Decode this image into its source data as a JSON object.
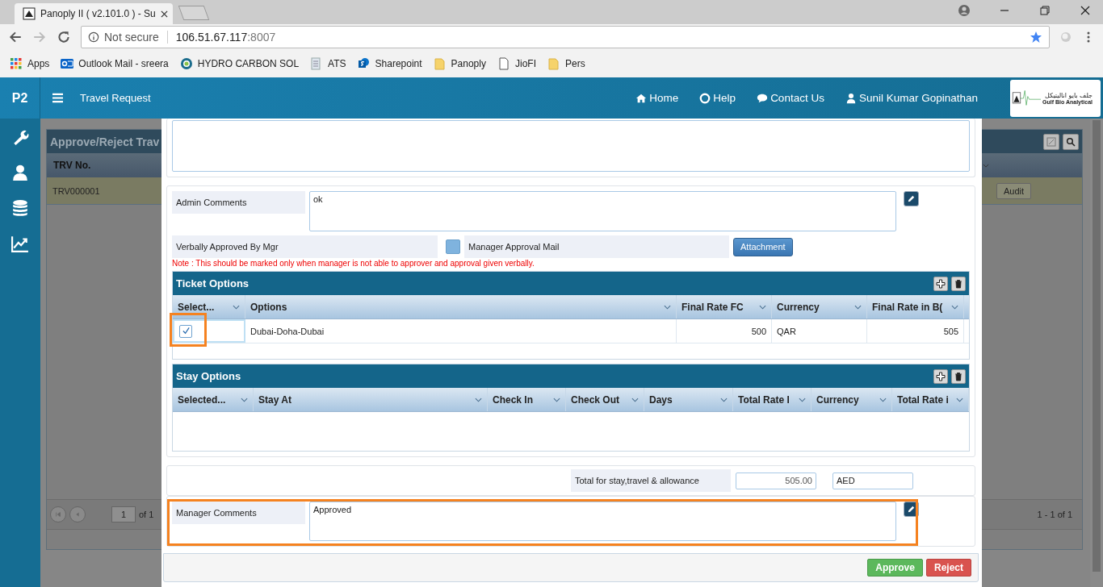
{
  "browser": {
    "tabs": [
      {
        "title": "Panoply II ( v2.101.0 ) - Su",
        "selected": true
      }
    ],
    "security": "Not secure",
    "url_host": "106.51.67.117",
    "url_port": ":8007",
    "bookmarks": [
      {
        "label": "Apps",
        "kind": "apps"
      },
      {
        "label": "Outlook Mail - sreera",
        "kind": "outlook"
      },
      {
        "label": "HYDRO CARBON SOL",
        "kind": "ring"
      },
      {
        "label": "ATS",
        "kind": "document"
      },
      {
        "label": "Sharepoint",
        "kind": "sharepoint"
      },
      {
        "label": "Panoply",
        "kind": "folder"
      },
      {
        "label": "JioFI",
        "kind": "page"
      },
      {
        "label": "Pers",
        "kind": "folder"
      }
    ]
  },
  "app": {
    "logo": "P2",
    "title": "Travel Request",
    "nav": [
      {
        "label": "Home",
        "kind": "home"
      },
      {
        "label": "Help",
        "kind": "help"
      },
      {
        "label": "Contact Us",
        "kind": "chat"
      }
    ],
    "user": "Sunil Kumar Gopinathan",
    "company_arabic": "جلف بايو اناليتيكل",
    "company_name": "Gulf Bio Analytical"
  },
  "background_list": {
    "title": "Approve/Reject Trav",
    "column": "TRV No.",
    "row": "TRV000001",
    "action": "Audit",
    "page": "1",
    "page_of": "of 1",
    "range": "1 - 1 of 1"
  },
  "form": {
    "admin_comments": {
      "label": "Admin Comments",
      "value": "ok"
    },
    "verbally_approved": {
      "label": "Verbally Approved By Mgr",
      "checked": false
    },
    "approval_mail": {
      "label": "Manager Approval Mail",
      "button": "Attachment"
    },
    "note": "Note : This should be marked only when manager is not able to approver and approval given verbally.",
    "ticket_options": {
      "title": "Ticket Options",
      "columns": [
        "Select...",
        "Options",
        "Final Rate FC",
        "Currency",
        "Final Rate in B("
      ],
      "rows": [
        {
          "checked": true,
          "option": "Dubai-Doha-Dubai",
          "final_rate_fc": "500",
          "currency": "QAR",
          "final_rate": "505"
        }
      ]
    },
    "stay_options": {
      "title": "Stay Options",
      "columns": [
        "Selected...",
        "Stay At",
        "Check In",
        "Check Out",
        "Days",
        "Total Rate I",
        "Currency",
        "Total Rate i"
      ]
    },
    "total": {
      "label": "Total for stay,travel & allowance",
      "amount": "505.00",
      "currency": "AED"
    },
    "manager_comments": {
      "label": "Manager Comments",
      "value": "Approved"
    },
    "buttons": [
      {
        "label": "Approve",
        "kind": "approve"
      },
      {
        "label": "Reject",
        "kind": "reject"
      }
    ]
  }
}
